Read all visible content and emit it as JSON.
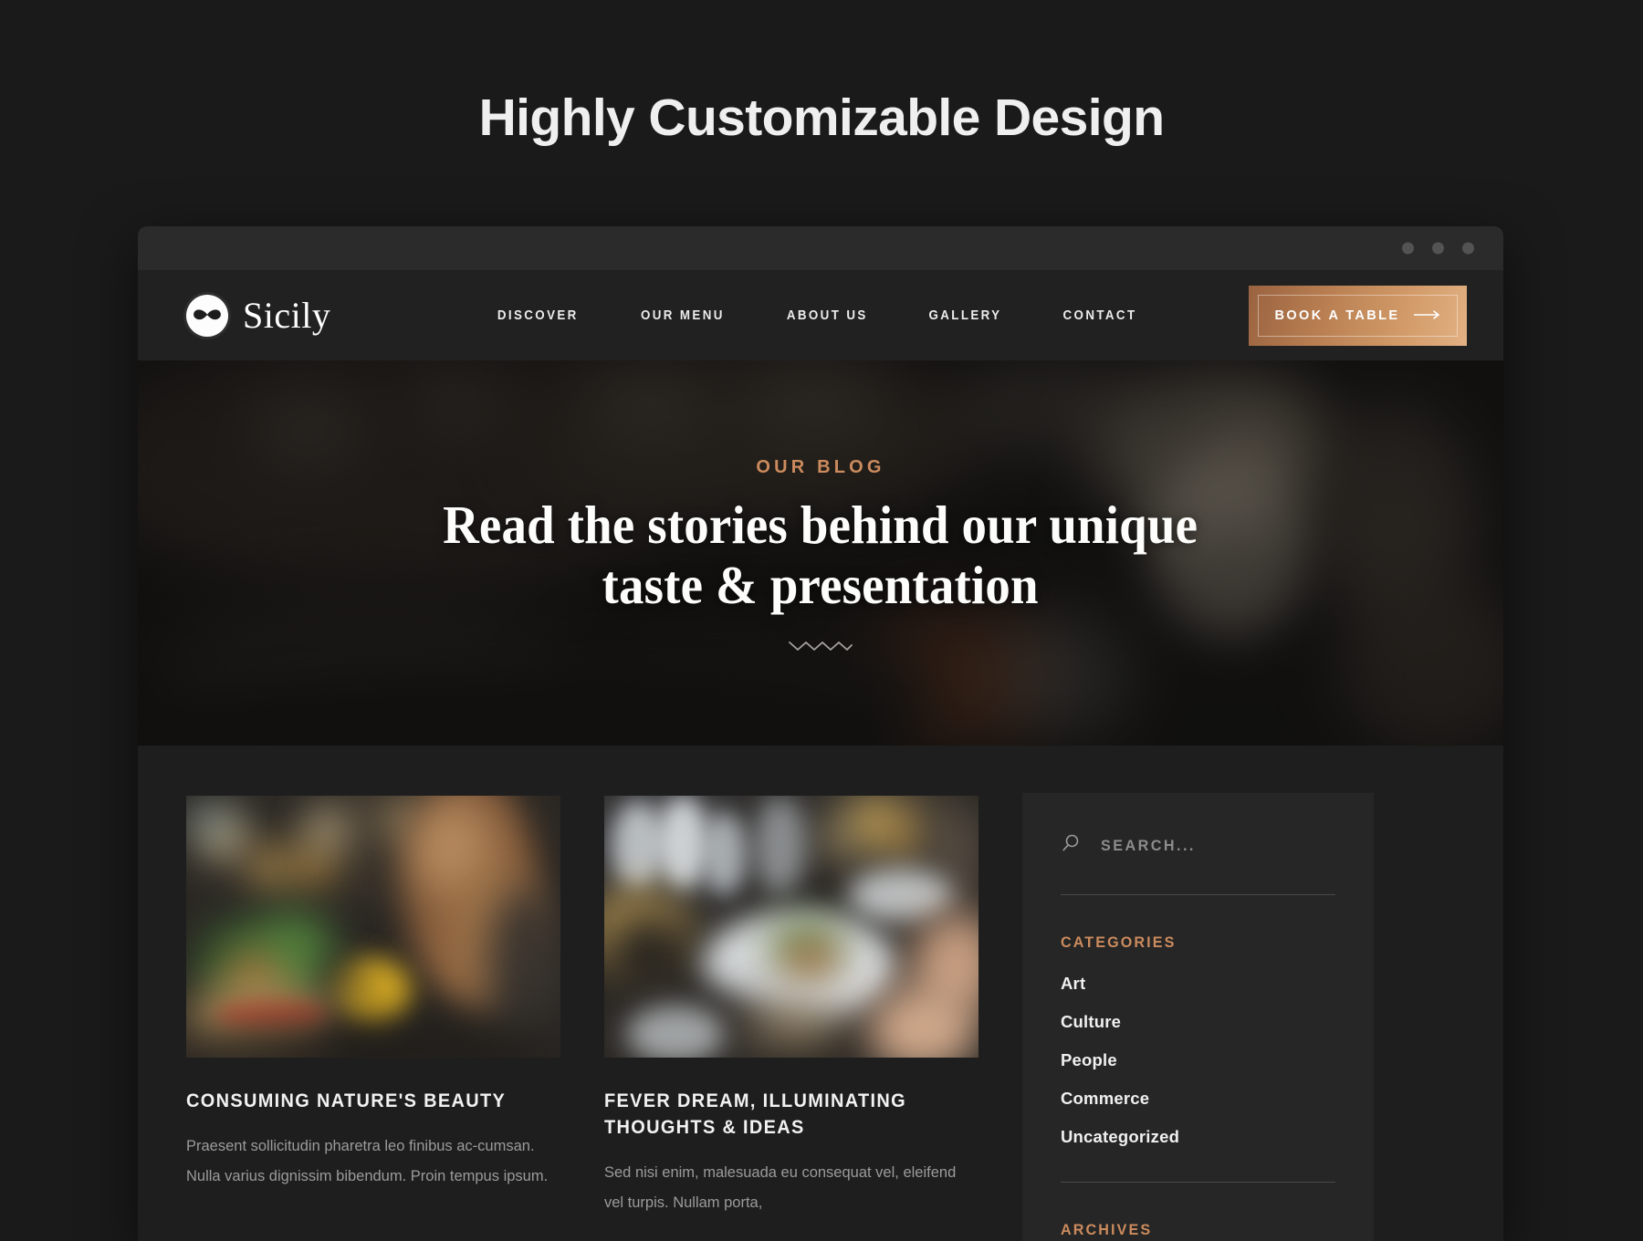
{
  "promo": {
    "title": "Highly Customizable Design"
  },
  "browser": {
    "dots": [
      "window-dot-1",
      "window-dot-2",
      "window-dot-3"
    ]
  },
  "header": {
    "brand": {
      "name": "Sicily",
      "logo_icon": "mustache-icon"
    },
    "nav": [
      {
        "label": "DISCOVER"
      },
      {
        "label": "OUR MENU"
      },
      {
        "label": "ABOUT US"
      },
      {
        "label": "GALLERY"
      },
      {
        "label": "CONTACT"
      }
    ],
    "cta": {
      "label": "BOOK A TABLE",
      "icon": "arrow-right-icon",
      "color": "#c08a5c"
    }
  },
  "hero": {
    "eyebrow": "OUR BLOG",
    "title_line_1": "Read the stories behind our unique",
    "title_line_2": "taste & presentation",
    "ornament_icon": "zigzag-divider-icon",
    "eyebrow_color": "#cc8b5d"
  },
  "posts": [
    {
      "title": "CONSUMING NATURE'S BEAUTY",
      "excerpt": "Praesent sollicitudin pharetra leo finibus ac-cumsan. Nulla varius dignissim bibendum. Proin tempus ipsum.",
      "image_alt": "woman-eating-in-cafe"
    },
    {
      "title": "FEVER DREAM, ILLUMINATING THOUGHTS & IDEAS",
      "excerpt": "Sed nisi enim, malesuada eu consequat vel, eleifend vel turpis. Nullam porta,",
      "image_alt": "plated-dish-at-dinner-table"
    }
  ],
  "sidebar": {
    "search": {
      "placeholder": "SEARCH...",
      "value": "",
      "icon": "search-icon"
    },
    "categories": {
      "title": "CATEGORIES",
      "items": [
        {
          "label": "Art"
        },
        {
          "label": "Culture"
        },
        {
          "label": "People"
        },
        {
          "label": "Commerce"
        },
        {
          "label": "Uncategorized"
        }
      ]
    },
    "archives": {
      "title": "ARCHIVES"
    },
    "accent_color": "#cc8b5d"
  }
}
